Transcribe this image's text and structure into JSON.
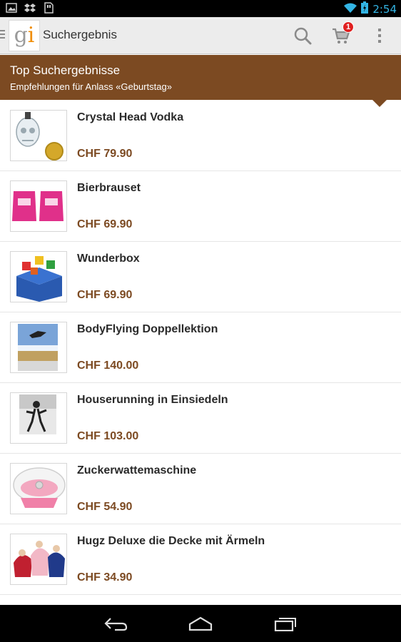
{
  "status_bar": {
    "time": "2:54",
    "icons": [
      "image-icon",
      "dropbox-icon",
      "sd-card-icon",
      "wifi-icon",
      "battery-icon"
    ]
  },
  "action_bar": {
    "logo_g": "g",
    "logo_i": "i",
    "title": "Suchergebnis",
    "cart_count": "1",
    "icons": [
      "menu-lines-icon",
      "search-icon",
      "cart-icon",
      "overflow-menu-icon"
    ]
  },
  "banner": {
    "title": "Top Suchergebnisse",
    "subtitle": "Empfehlungen für Anlass «Geburtstag»"
  },
  "items": [
    {
      "title": "Crystal Head Vodka",
      "price": "CHF 79.90"
    },
    {
      "title": "Bierbrauset",
      "price": "CHF 69.90"
    },
    {
      "title": "Wunderbox",
      "price": "CHF 69.90"
    },
    {
      "title": "BodyFlying Doppellektion",
      "price": "CHF 140.00"
    },
    {
      "title": "Houserunning in Einsiedeln",
      "price": "CHF 103.00"
    },
    {
      "title": "Zuckerwattemaschine",
      "price": "CHF 54.90"
    },
    {
      "title": "Hugz Deluxe die Decke mit Ärmeln",
      "price": "CHF 34.90"
    }
  ],
  "nav_bar": {
    "icons": [
      "back-icon",
      "home-icon",
      "recent-apps-icon"
    ]
  },
  "colors": {
    "accent_brown": "#7c4a22",
    "status_blue": "#33b5e5",
    "badge_red": "#e02020"
  }
}
